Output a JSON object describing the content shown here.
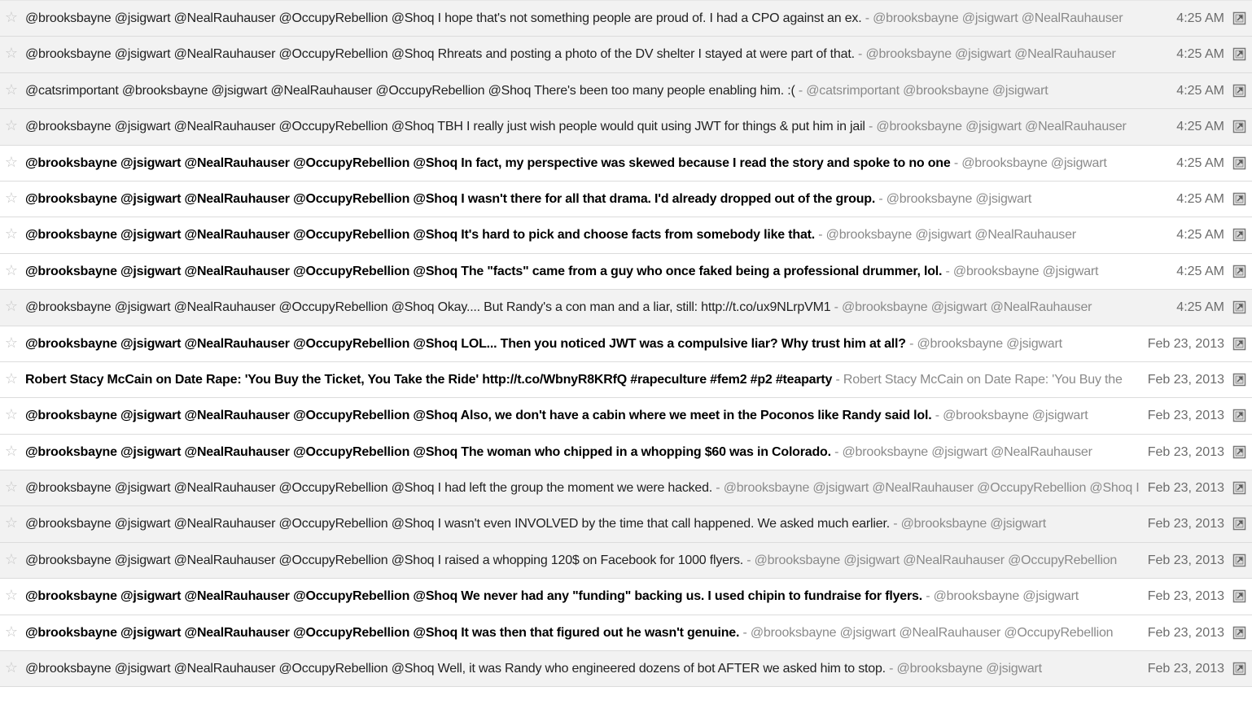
{
  "separator": " - ",
  "colors": {
    "read_row_bg": "#f2f2f2",
    "unread_row_bg": "#ffffff",
    "snippet": "#8a8a8a",
    "star": "#c6c6c6"
  },
  "icons": {
    "star": "star-icon",
    "open": "open-in-new-window-icon"
  },
  "messages": [
    {
      "unread": false,
      "subject": "@brooksbayne @jsigwart @NealRauhauser @OccupyRebellion @Shoq I hope that's not something people are proud of. I had a CPO against an ex.",
      "snippet": "@brooksbayne @jsigwart @NealRauhauser",
      "date": "4:25 AM"
    },
    {
      "unread": false,
      "subject": "@brooksbayne @jsigwart @NealRauhauser @OccupyRebellion @Shoq Rhreats and posting a photo of the DV shelter I stayed at were part of that.",
      "snippet": "@brooksbayne @jsigwart @NealRauhauser",
      "date": "4:25 AM"
    },
    {
      "unread": false,
      "subject": "@catsrimportant @brooksbayne @jsigwart @NealRauhauser @OccupyRebellion @Shoq There's been too many people enabling him. :(",
      "snippet": "@catsrimportant @brooksbayne @jsigwart",
      "date": "4:25 AM"
    },
    {
      "unread": false,
      "subject": "@brooksbayne @jsigwart @NealRauhauser @OccupyRebellion @Shoq TBH I really just wish people would quit using JWT for things & put him in jail",
      "snippet": "@brooksbayne @jsigwart @NealRauhauser",
      "date": "4:25 AM"
    },
    {
      "unread": true,
      "subject": "@brooksbayne @jsigwart @NealRauhauser @OccupyRebellion @Shoq In fact, my perspective was skewed because I read the story and spoke to no one",
      "snippet": "@brooksbayne @jsigwart",
      "date": "4:25 AM"
    },
    {
      "unread": true,
      "subject": "@brooksbayne @jsigwart @NealRauhauser @OccupyRebellion @Shoq I wasn't there for all that drama. I'd already dropped out of the group.",
      "snippet": "@brooksbayne @jsigwart",
      "date": "4:25 AM"
    },
    {
      "unread": true,
      "subject": "@brooksbayne @jsigwart @NealRauhauser @OccupyRebellion @Shoq It's hard to pick and choose facts from somebody like that.",
      "snippet": "@brooksbayne @jsigwart @NealRauhauser",
      "date": "4:25 AM"
    },
    {
      "unread": true,
      "subject": "@brooksbayne @jsigwart @NealRauhauser @OccupyRebellion @Shoq The \"facts\" came from a guy who once faked being a professional drummer, lol.",
      "snippet": "@brooksbayne @jsigwart",
      "date": "4:25 AM"
    },
    {
      "unread": false,
      "subject": "@brooksbayne @jsigwart @NealRauhauser @OccupyRebellion @Shoq Okay.... But Randy's a con man and a liar, still: http://t.co/ux9NLrpVM1",
      "snippet": "@brooksbayne @jsigwart @NealRauhauser",
      "date": "4:25 AM"
    },
    {
      "unread": true,
      "subject": "@brooksbayne @jsigwart @NealRauhauser @OccupyRebellion @Shoq LOL... Then you noticed JWT was a compulsive liar? Why trust him at all?",
      "snippet": "@brooksbayne @jsigwart",
      "date": "Feb 23, 2013"
    },
    {
      "unread": true,
      "subject": "Robert Stacy McCain on Date Rape: 'You Buy the Ticket, You Take the Ride' http://t.co/WbnyR8KRfQ #rapeculture #fem2 #p2 #teaparty",
      "snippet": "Robert Stacy McCain on Date Rape: 'You Buy the",
      "date": "Feb 23, 2013"
    },
    {
      "unread": true,
      "subject": "@brooksbayne @jsigwart @NealRauhauser @OccupyRebellion @Shoq Also, we don't have a cabin where we meet in the Poconos like Randy said lol.",
      "snippet": "@brooksbayne @jsigwart",
      "date": "Feb 23, 2013"
    },
    {
      "unread": true,
      "subject": "@brooksbayne @jsigwart @NealRauhauser @OccupyRebellion @Shoq The woman who chipped in a whopping $60 was in Colorado.",
      "snippet": "@brooksbayne @jsigwart @NealRauhauser",
      "date": "Feb 23, 2013"
    },
    {
      "unread": false,
      "subject": "@brooksbayne @jsigwart @NealRauhauser @OccupyRebellion @Shoq I had left the group the moment we were hacked.",
      "snippet": "@brooksbayne @jsigwart @NealRauhauser @OccupyRebellion @Shoq I",
      "date": "Feb 23, 2013"
    },
    {
      "unread": false,
      "subject": "@brooksbayne @jsigwart @NealRauhauser @OccupyRebellion @Shoq I wasn't even INVOLVED by the time that call happened. We asked much earlier.",
      "snippet": "@brooksbayne @jsigwart",
      "date": "Feb 23, 2013"
    },
    {
      "unread": false,
      "subject": "@brooksbayne @jsigwart @NealRauhauser @OccupyRebellion @Shoq I raised a whopping 120$ on Facebook for 1000 flyers.",
      "snippet": "@brooksbayne @jsigwart @NealRauhauser @OccupyRebellion",
      "date": "Feb 23, 2013"
    },
    {
      "unread": true,
      "subject": "@brooksbayne @jsigwart @NealRauhauser @OccupyRebellion @Shoq We never had any \"funding\" backing us. I used chipin to fundraise for flyers.",
      "snippet": "@brooksbayne @jsigwart",
      "date": "Feb 23, 2013"
    },
    {
      "unread": true,
      "subject": "@brooksbayne @jsigwart @NealRauhauser @OccupyRebellion @Shoq It was then that figured out he wasn't genuine.",
      "snippet": "@brooksbayne @jsigwart @NealRauhauser @OccupyRebellion",
      "date": "Feb 23, 2013"
    },
    {
      "unread": false,
      "subject": "@brooksbayne @jsigwart @NealRauhauser @OccupyRebellion @Shoq Well, it was Randy who engineered dozens of bot AFTER we asked him to stop.",
      "snippet": "@brooksbayne @jsigwart",
      "date": "Feb 23, 2013"
    }
  ]
}
